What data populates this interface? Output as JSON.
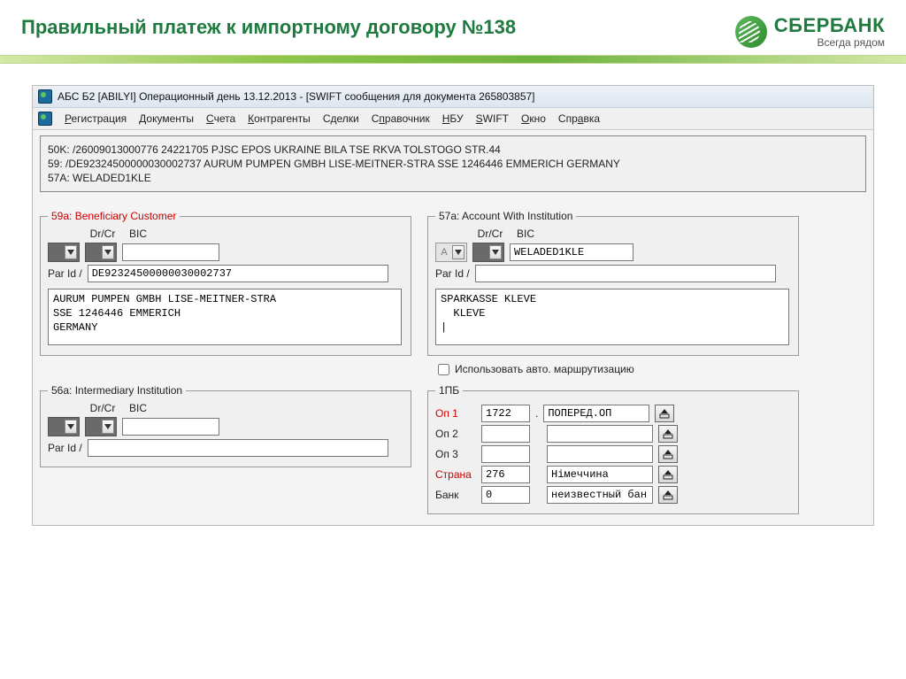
{
  "slide": {
    "title": "Правильный платеж к импортному договору №138"
  },
  "logo": {
    "brand": "СБЕРБАНК",
    "tagline": "Всегда рядом"
  },
  "window": {
    "title": "АБС Б2 [ABILYI] Операционный день 13.12.2013 - [SWIFT сообщения для документа 265803857]"
  },
  "menu": {
    "reg": "Регистрация",
    "doc": "Документы",
    "acct": "Счета",
    "contr": "Контрагенты",
    "deals": "Сделки",
    "ref": "Справочник",
    "nbu": "НБУ",
    "swift": "SWIFT",
    "win": "Окно",
    "help": "Справка"
  },
  "swift": {
    "l1": "50K: /26009013000776 24221705 PJSC EPOS UKRAINE BILA TSE RKVA TOLSTOGO STR.44",
    "l2": "59: /DE92324500000030002737 AURUM PUMPEN GMBH LISE-MEITNER-STRA SSE 1246446 EMMERICH GERMANY",
    "l3": "57A: WELADED1KLE"
  },
  "labels": {
    "drcr": "Dr/Cr",
    "bic": "BIC",
    "parid": "Par Id /",
    "fs59a": "59a: Beneficiary Customer",
    "fs57a": "57a: Account With Institution",
    "fs56a": "56a: Intermediary Institution",
    "fs1pb": "1ПБ",
    "useauto": "Использовать авто. маршрутизацию",
    "op1": "Оп 1",
    "op2": "Оп 2",
    "op3": "Оп 3",
    "country": "Страна",
    "bank": "Банк"
  },
  "f59a": {
    "parid": "DE92324500000030002737",
    "body": "AURUM PUMPEN GMBH LISE-MEITNER-STRA\nSSE 1246446 EMMERICH\nGERMANY"
  },
  "f57a": {
    "combo_letter": "A",
    "bic": "WELADED1KLE",
    "parid": "",
    "body": "SPARKASSE KLEVE\n  KLEVE\n|"
  },
  "f56a": {
    "parid": ""
  },
  "pb": {
    "op1_code": "1722",
    "op1_dot": ".",
    "op1_desc": "ПОПЕРЕД.ОП",
    "op2_code": "",
    "op2_desc": "",
    "op3_code": "",
    "op3_desc": "",
    "country_code": "276",
    "country_name": "Німеччина",
    "bank_code": "0",
    "bank_name": "неизвестный бан"
  }
}
